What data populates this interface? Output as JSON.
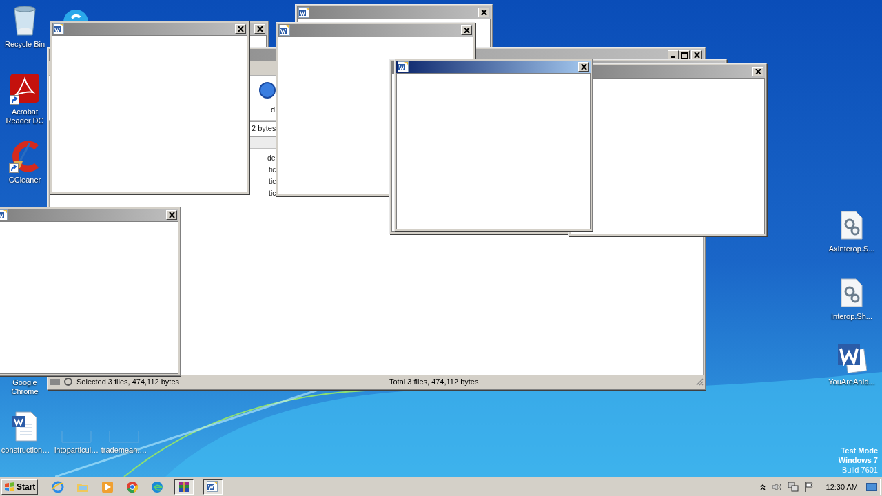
{
  "desktop_icons": [
    {
      "kind": "recycle-bin",
      "label": "Recycle Bin",
      "shortcut": false
    },
    {
      "kind": "skype",
      "shortcut": false
    },
    {
      "kind": "acrobat",
      "label": "Acrobat Reader DC",
      "shortcut": true
    },
    {
      "kind": "ccleaner",
      "label": "CCleaner",
      "shortcut": true
    },
    {
      "kind": "covered",
      "label": "Google Chrome"
    },
    {
      "kind": "word-doc",
      "label": "construction…",
      "shortcut": false
    },
    {
      "kind": "blank",
      "label": "intoparticul…",
      "shortcut": false
    },
    {
      "kind": "blank",
      "label": "trademean.…",
      "shortcut": false
    },
    {
      "kind": "config",
      "label": "AxInterop.S...",
      "shortcut": false
    },
    {
      "kind": "config",
      "label": "Interop.Sh...",
      "shortcut": false
    },
    {
      "kind": "word",
      "label": "YouAreAnId...",
      "shortcut": false
    }
  ],
  "windows": [
    {
      "kind": "popup",
      "active": false
    },
    {
      "kind": "popup",
      "active": false
    },
    {
      "kind": "explorer",
      "active": false,
      "fragments": [
        {
          "kind": "toolbar",
          "text": "d"
        },
        {
          "kind": "address",
          "text": "2 bytes"
        },
        {
          "kind": "list",
          "text": "de"
        },
        {
          "kind": "list",
          "text": "tic"
        },
        {
          "kind": "list",
          "text": "tic"
        },
        {
          "kind": "list",
          "text": "tic"
        }
      ],
      "status_bar": [
        "Selected 3 files, 474,112 bytes",
        "Total 3 files, 474,112 bytes"
      ]
    },
    {
      "kind": "popup",
      "active": false
    },
    {
      "kind": "popup",
      "active": false
    },
    {
      "kind": "popup",
      "active": false
    },
    {
      "kind": "popup",
      "active": false
    },
    {
      "kind": "popup",
      "active": true
    },
    {
      "kind": "popup",
      "active": false
    }
  ],
  "desktop_notice": [
    {
      "text": "Test Mode",
      "bold": true
    },
    {
      "text": "Windows 7",
      "bold": true
    },
    {
      "text": "Build 7601",
      "bold": false
    }
  ],
  "taskbar": {
    "start": "Start",
    "apps": [
      {
        "kind": "ie",
        "selected": false
      },
      {
        "kind": "folder",
        "selected": false
      },
      {
        "kind": "media",
        "selected": false
      },
      {
        "kind": "chrome",
        "selected": false
      },
      {
        "kind": "edge",
        "selected": false
      },
      {
        "kind": "winrar",
        "selected": true
      },
      {
        "kind": "word",
        "selected": true
      }
    ],
    "tray": {
      "time": "12:30 AM"
    }
  }
}
